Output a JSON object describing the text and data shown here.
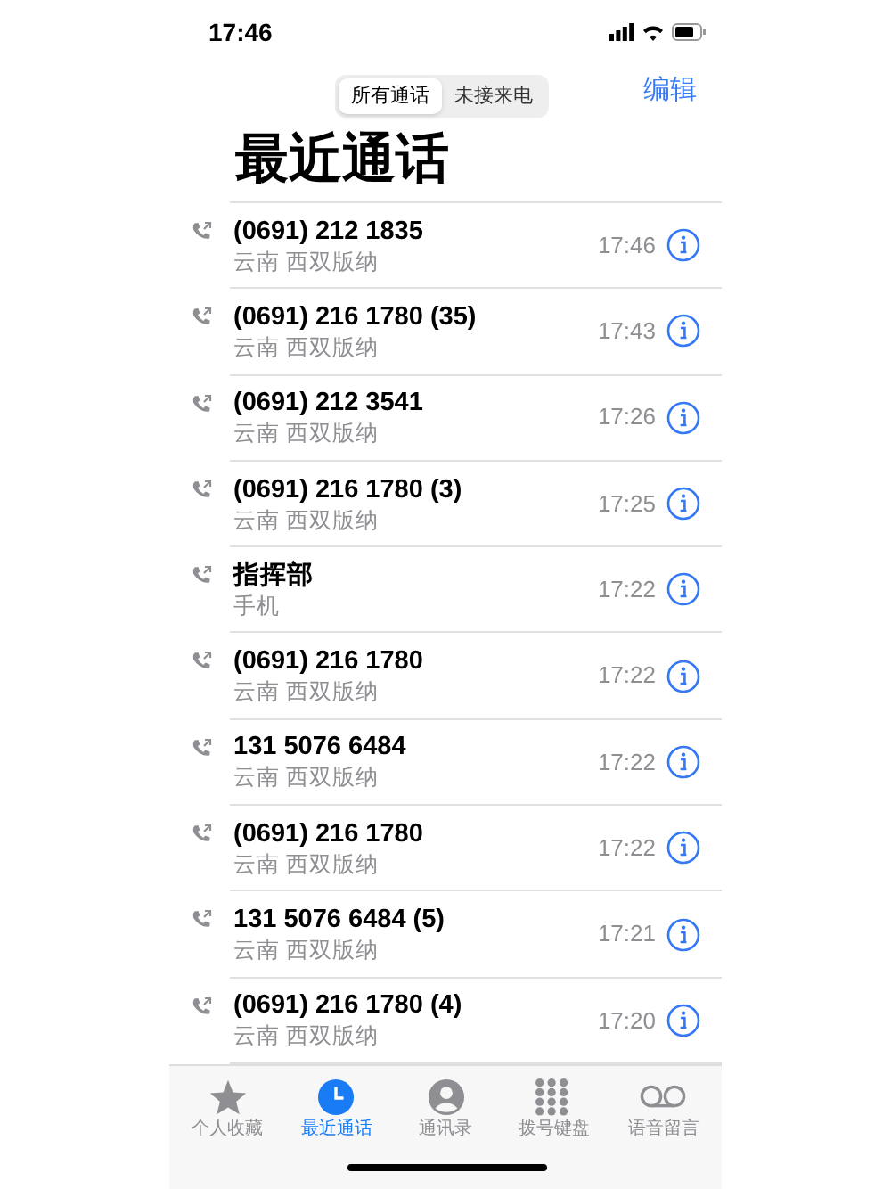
{
  "status_bar": {
    "time": "17:46"
  },
  "segments": [
    {
      "label": "所有通话",
      "selected": true
    },
    {
      "label": "未接来电",
      "selected": false
    }
  ],
  "edit_button": "编辑",
  "title": "最近通话",
  "calls": [
    {
      "name": "(0691) 212 1835",
      "detail": "云南 西双版纳",
      "time": "17:46"
    },
    {
      "name": "(0691) 216 1780 (35)",
      "detail": "云南 西双版纳",
      "time": "17:43"
    },
    {
      "name": "(0691) 212 3541",
      "detail": "云南 西双版纳",
      "time": "17:26"
    },
    {
      "name": "(0691) 216 1780 (3)",
      "detail": "云南 西双版纳",
      "time": "17:25"
    },
    {
      "name": "指挥部",
      "detail": "手机",
      "time": "17:22"
    },
    {
      "name": "(0691) 216 1780",
      "detail": "云南 西双版纳",
      "time": "17:22"
    },
    {
      "name": "131 5076 6484",
      "detail": "云南 西双版纳",
      "time": "17:22"
    },
    {
      "name": "(0691) 216 1780",
      "detail": "云南 西双版纳",
      "time": "17:22"
    },
    {
      "name": "131 5076 6484 (5)",
      "detail": "云南 西双版纳",
      "time": "17:21"
    },
    {
      "name": "(0691) 216 1780 (4)",
      "detail": "云南 西双版纳",
      "time": "17:20"
    }
  ],
  "tab_bar": [
    {
      "kind": "star",
      "label": "个人收藏",
      "selected": false
    },
    {
      "kind": "clock",
      "label": "最近通话",
      "selected": true
    },
    {
      "kind": "person",
      "label": "通讯录",
      "selected": false
    },
    {
      "kind": "keypad",
      "label": "拨号键盘",
      "selected": false
    },
    {
      "kind": "voicemail",
      "label": "语音留言",
      "selected": false
    }
  ]
}
